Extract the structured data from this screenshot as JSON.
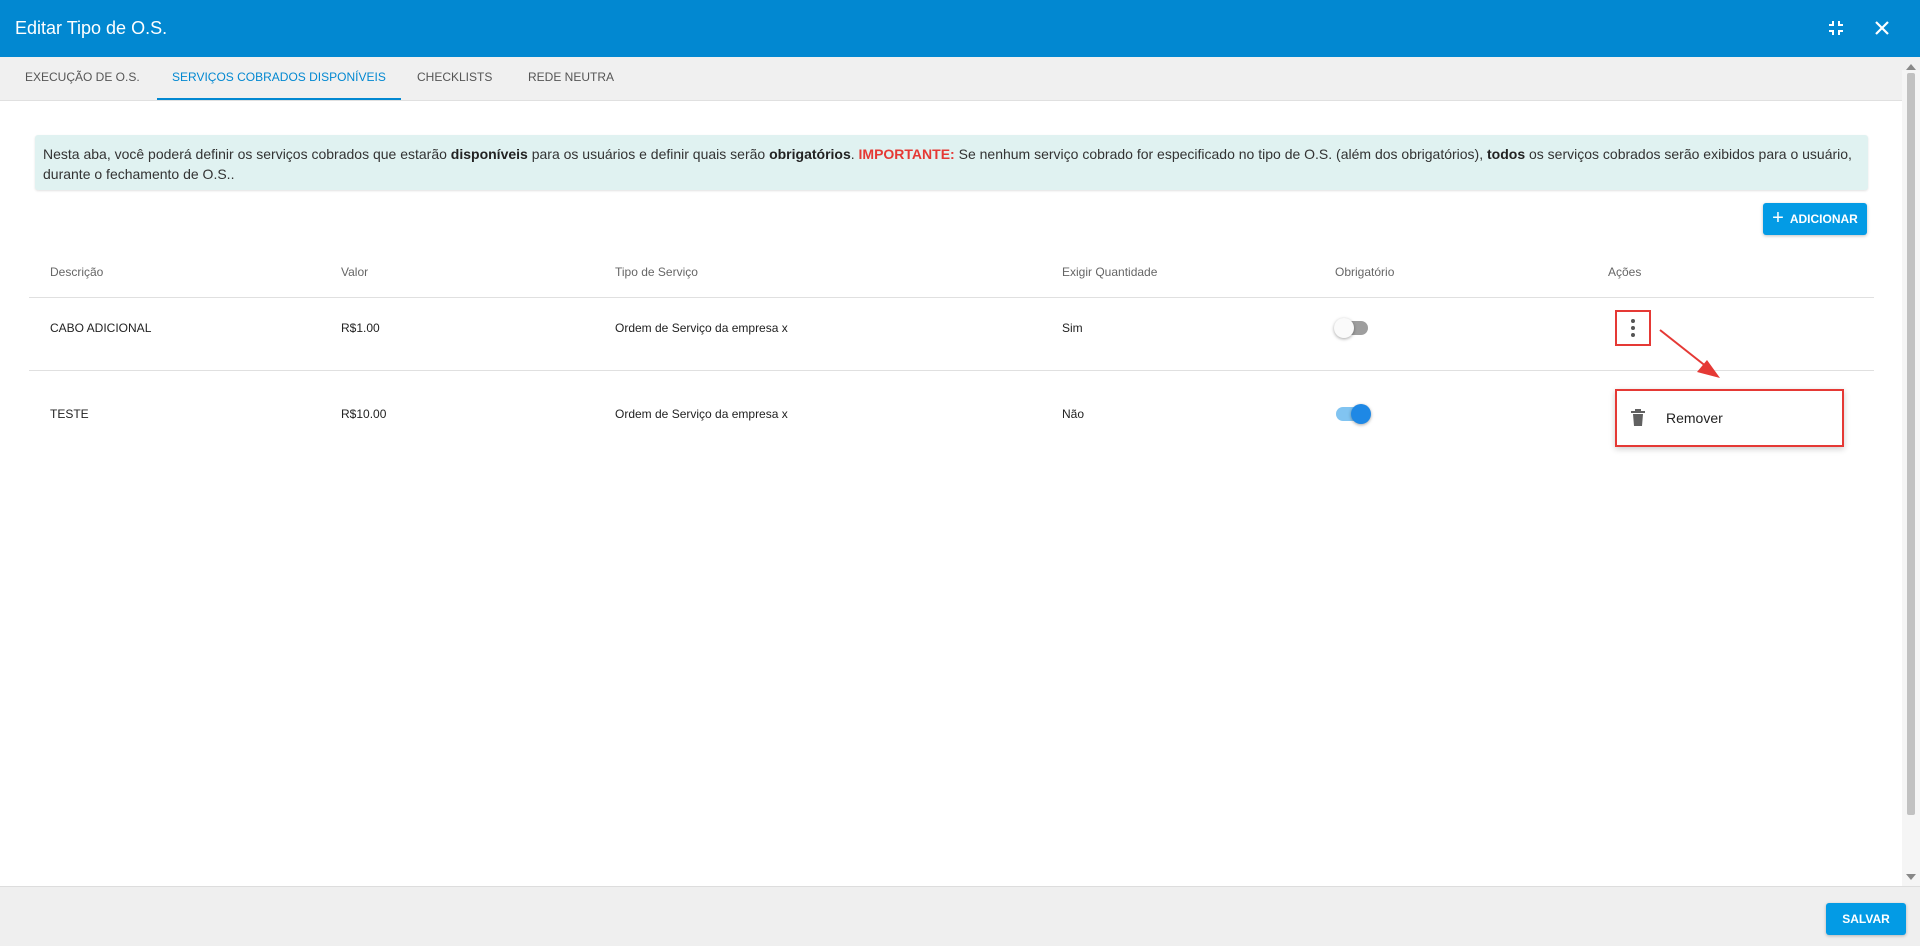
{
  "dialog": {
    "title": "Editar Tipo de O.S."
  },
  "tabs": [
    {
      "label": "EXECUÇÃO DE O.S."
    },
    {
      "label": "SERVIÇOS COBRADOS DISPONÍVEIS"
    },
    {
      "label": "CHECKLISTS"
    },
    {
      "label": "REDE NEUTRA"
    }
  ],
  "info": {
    "part1": "Nesta aba, você poderá definir os serviços cobrados que estarão ",
    "bold1": "disponíveis",
    "part2": " para os usuários e definir quais serão ",
    "bold2": "obrigatórios",
    "part3": ". ",
    "important": "IMPORTANTE:",
    "part4": " Se nenhum serviço cobrado for especificado no tipo de O.S. (além dos obrigatórios), ",
    "bold3": "todos",
    "part5": " os serviços cobrados serão exibidos para o usuário, durante o fechamento de O.S.."
  },
  "add_button": {
    "label": "ADICIONAR"
  },
  "table": {
    "headers": [
      "Descrição",
      "Valor",
      "Tipo de Serviço",
      "Exigir Quantidade",
      "Obrigatório",
      "Ações"
    ],
    "rows": [
      {
        "descricao": "CABO ADICIONAL",
        "valor": "R$1.00",
        "tipo": "Ordem de Serviço da empresa x",
        "exigir": "Sim",
        "obrigatorio": false
      },
      {
        "descricao": "TESTE",
        "valor": "R$10.00",
        "tipo": "Ordem de Serviço da empresa x",
        "exigir": "Não",
        "obrigatorio": true
      }
    ]
  },
  "context_menu": {
    "remove_label": "Remover"
  },
  "footer": {
    "save_label": "SALVAR"
  },
  "colors": {
    "primary": "#0288d1",
    "button": "#039be5",
    "highlight": "#e53935",
    "info_bg": "#e0f2f1"
  },
  "icons": {
    "compress": "compress-icon",
    "close": "close-icon",
    "add": "plus-icon",
    "more": "more-vert-icon",
    "delete": "trash-icon"
  }
}
